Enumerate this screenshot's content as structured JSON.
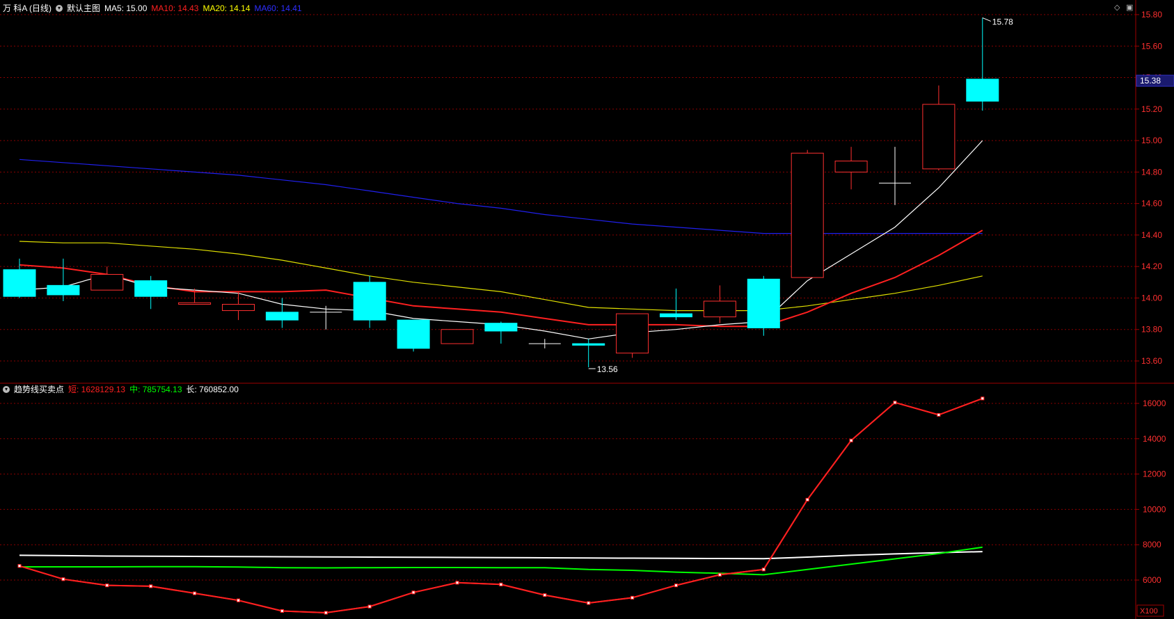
{
  "main_header": {
    "stock_name": "万 科A (日线)",
    "template_label": "默认主图",
    "ma5": {
      "label": "MA5: 15.00",
      "color": "#ffffff"
    },
    "ma10": {
      "label": "MA10: 14.43",
      "color": "#ff2020"
    },
    "ma20": {
      "label": "MA20: 14.14",
      "color": "#ffff00"
    },
    "ma60": {
      "label": "MA60: 14.41",
      "color": "#2020ff"
    }
  },
  "sub_header": {
    "indicator_name": "趋势线买卖点",
    "short": {
      "label": "短: 1628129.13",
      "color": "#ff2020"
    },
    "mid": {
      "label": "中: 785754.13",
      "color": "#00ff00"
    },
    "long": {
      "label": "长: 760852.00",
      "color": "#ffffff"
    }
  },
  "icons": {
    "diamond": "diamond-icon",
    "window": "window-icon",
    "chevron": "chevron-down-icon"
  },
  "colors": {
    "up": "#ff3030",
    "down": "#00ffff",
    "grid": "#8b0000",
    "axis_text": "#ff3030"
  },
  "chart_data": [
    {
      "type": "candlestick",
      "price_axis": {
        "ylim": [
          13.5,
          15.85
        ],
        "ticks": [
          "15.80",
          "15.60",
          "15.40",
          "15.20",
          "15.00",
          "14.80",
          "14.60",
          "14.40",
          "14.20",
          "14.00",
          "13.80",
          "13.60"
        ]
      },
      "current_price": "15.38",
      "annotations": {
        "high": "15.78",
        "low": "13.56"
      },
      "candles": [
        {
          "o": 14.18,
          "h": 14.25,
          "l": 14.0,
          "c": 14.01
        },
        {
          "o": 14.08,
          "h": 14.25,
          "l": 13.98,
          "c": 14.02
        },
        {
          "o": 14.05,
          "h": 14.2,
          "l": 14.05,
          "c": 14.15
        },
        {
          "o": 14.11,
          "h": 14.14,
          "l": 13.93,
          "c": 14.01
        },
        {
          "o": 13.96,
          "h": 14.06,
          "l": 13.96,
          "c": 13.97
        },
        {
          "o": 13.92,
          "h": 14.04,
          "l": 13.86,
          "c": 13.96
        },
        {
          "o": 13.91,
          "h": 14.0,
          "l": 13.81,
          "c": 13.86
        },
        {
          "o": 13.91,
          "h": 13.95,
          "l": 13.8,
          "c": 13.91
        },
        {
          "o": 14.1,
          "h": 14.14,
          "l": 13.81,
          "c": 13.86
        },
        {
          "o": 13.86,
          "h": 13.86,
          "l": 13.66,
          "c": 13.68
        },
        {
          "o": 13.71,
          "h": 13.8,
          "l": 13.71,
          "c": 13.8
        },
        {
          "o": 13.84,
          "h": 13.85,
          "l": 13.71,
          "c": 13.79
        },
        {
          "o": 13.71,
          "h": 13.74,
          "l": 13.68,
          "c": 13.71
        },
        {
          "o": 13.71,
          "h": 13.74,
          "l": 13.56,
          "c": 13.7
        },
        {
          "o": 13.65,
          "h": 13.9,
          "l": 13.62,
          "c": 13.9
        },
        {
          "o": 13.9,
          "h": 14.06,
          "l": 13.86,
          "c": 13.88
        },
        {
          "o": 13.88,
          "h": 14.08,
          "l": 13.84,
          "c": 13.98
        },
        {
          "o": 14.12,
          "h": 14.14,
          "l": 13.76,
          "c": 13.81
        },
        {
          "o": 14.13,
          "h": 14.94,
          "l": 14.13,
          "c": 14.92
        },
        {
          "o": 14.8,
          "h": 14.96,
          "l": 14.69,
          "c": 14.87
        },
        {
          "o": 14.73,
          "h": 14.96,
          "l": 14.59,
          "c": 14.73
        },
        {
          "o": 14.82,
          "h": 15.35,
          "l": 14.81,
          "c": 15.23
        },
        {
          "o": 15.39,
          "h": 15.78,
          "l": 15.19,
          "c": 15.25
        }
      ],
      "ma5": [
        14.05,
        14.07,
        14.15,
        14.07,
        14.05,
        14.03,
        13.96,
        13.93,
        13.92,
        13.87,
        13.85,
        13.83,
        13.79,
        13.74,
        13.78,
        13.8,
        13.83,
        13.85,
        14.11,
        14.28,
        14.45,
        14.7,
        15.0
      ],
      "ma10": [
        14.21,
        14.19,
        14.15,
        14.08,
        14.04,
        14.04,
        14.04,
        14.05,
        14.0,
        13.95,
        13.93,
        13.91,
        13.87,
        13.83,
        13.83,
        13.83,
        13.82,
        13.82,
        13.91,
        14.03,
        14.13,
        14.27,
        14.43
      ],
      "ma20": [
        14.36,
        14.35,
        14.35,
        14.33,
        14.31,
        14.28,
        14.24,
        14.19,
        14.14,
        14.1,
        14.07,
        14.04,
        13.99,
        13.94,
        13.93,
        13.92,
        13.92,
        13.92,
        13.95,
        13.99,
        14.03,
        14.08,
        14.14
      ],
      "ma60": [
        14.88,
        14.86,
        14.84,
        14.82,
        14.8,
        14.78,
        14.75,
        14.72,
        14.68,
        14.64,
        14.6,
        14.57,
        14.53,
        14.5,
        14.47,
        14.45,
        14.43,
        14.41,
        14.41,
        14.41,
        14.41,
        14.41,
        14.41
      ]
    },
    {
      "type": "line",
      "y_axis": {
        "ylim": [
          5000,
          17000
        ],
        "ticks": [
          "16000",
          "14000",
          "12000",
          "10000",
          "8000",
          "6000"
        ],
        "unit": "X100"
      },
      "series": [
        {
          "name": "短",
          "color": "#ff2020",
          "markers": true,
          "values": [
            6800,
            6050,
            5700,
            5650,
            5250,
            4850,
            4250,
            4150,
            4500,
            5300,
            5850,
            5750,
            5150,
            4700,
            5000,
            5700,
            6300,
            6600,
            10550,
            13900,
            16050,
            15350,
            16280
          ]
        },
        {
          "name": "中",
          "color": "#00ff00",
          "values": [
            6750,
            6750,
            6750,
            6760,
            6760,
            6740,
            6700,
            6690,
            6700,
            6710,
            6710,
            6700,
            6700,
            6600,
            6550,
            6450,
            6380,
            6300,
            6600,
            6900,
            7200,
            7500,
            7860
          ]
        },
        {
          "name": "长",
          "color": "#ffffff",
          "values": [
            7400,
            7380,
            7360,
            7350,
            7340,
            7330,
            7320,
            7310,
            7300,
            7290,
            7280,
            7270,
            7260,
            7250,
            7240,
            7230,
            7220,
            7210,
            7300,
            7400,
            7480,
            7550,
            7610
          ]
        }
      ]
    }
  ]
}
